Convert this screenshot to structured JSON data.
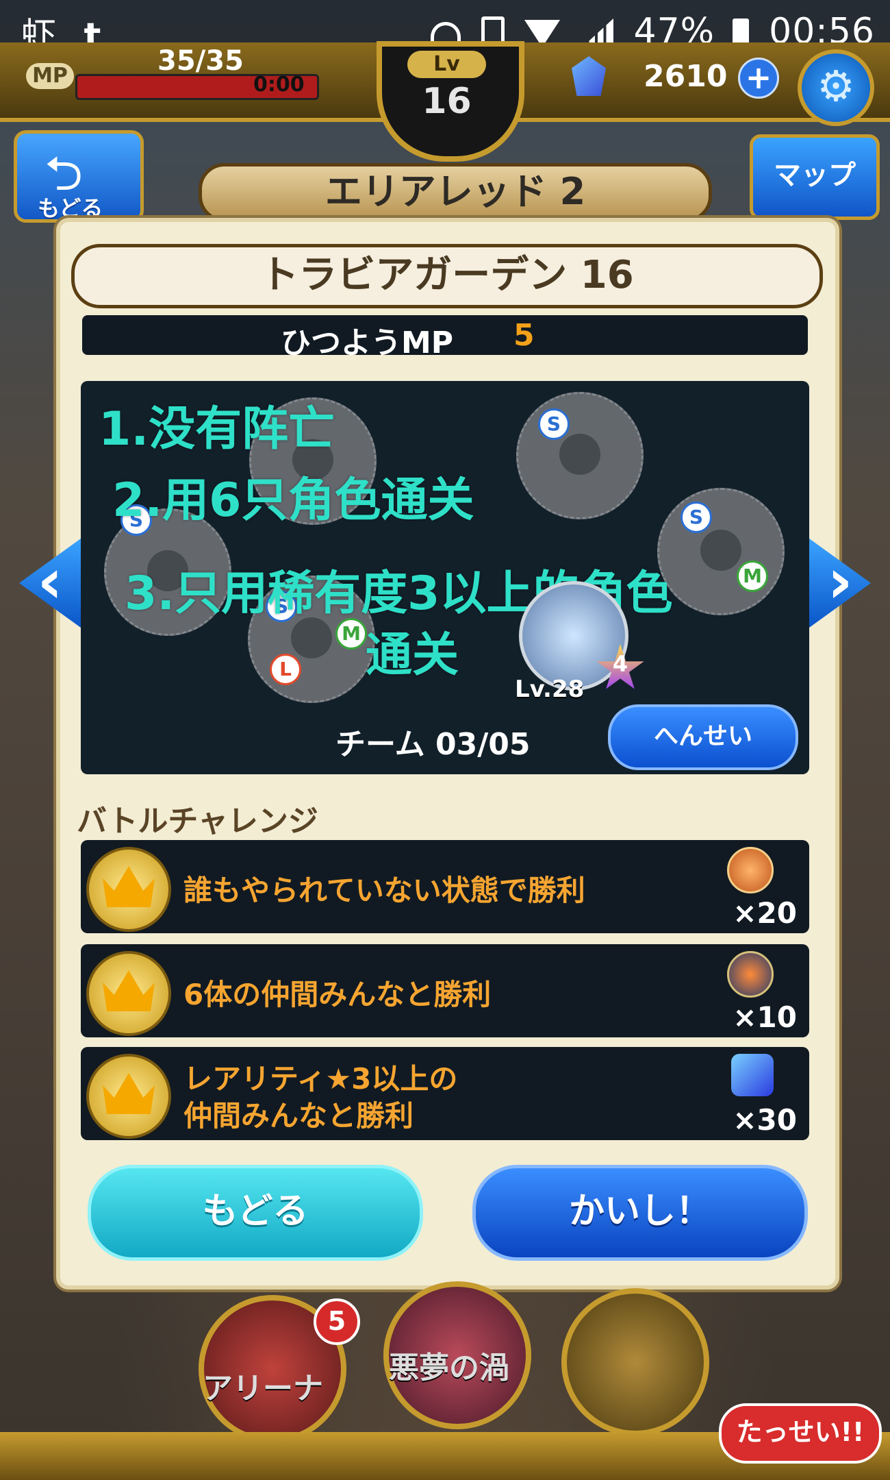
{
  "status_bar": {
    "left_glyph_1": "虾",
    "left_glyph_2": "t",
    "battery": "47%",
    "time": "00:56"
  },
  "hud": {
    "mp_label": "MP",
    "mp_value": "35/35",
    "mp_timer": "0:00",
    "lv_label": "Lv",
    "lv_value": "16",
    "gems": "2610",
    "plus": "+"
  },
  "header": {
    "back_label": "もどる",
    "map_label": "マップ",
    "area_name": "エリアレッド 2"
  },
  "stage": {
    "title": "トラビアガーデン 16",
    "mp_need_label": "ひつようMP",
    "mp_need_value": "5"
  },
  "party": {
    "slot_badges": [
      "S",
      "S",
      "S",
      "M",
      "S",
      "M",
      "L"
    ],
    "hero_level": "Lv.28",
    "hero_rank": "4",
    "team_count": "チーム 03/05",
    "edit_label": "へんせい",
    "annotation_1": "1.没有阵亡",
    "annotation_2": "2.用6只角色通关",
    "annotation_3": "3.只用稀有度3以上的角色",
    "annotation_3b": "通关"
  },
  "challenges": {
    "heading": "バトルチャレンジ",
    "items": [
      {
        "text": "誰もやられていない状態で勝利",
        "reward": "×20",
        "reward_icon": "turtle-medal-icon"
      },
      {
        "text": "6体の仲間みんなと勝利",
        "reward": "×10",
        "reward_icon": "star-medal-icon"
      },
      {
        "text_line1": "レアリティ★3以上の",
        "text_line2": "仲間みんなと勝利",
        "reward": "×30",
        "reward_icon": "gem-icon"
      }
    ]
  },
  "buttons": {
    "back": "もどる",
    "start": "かいし！"
  },
  "nav": {
    "arena": "アリーナ",
    "arena_badge": "5",
    "nightmare": "悪夢の渦",
    "achievement": "たっせい!!"
  },
  "colors": {
    "accent_gold": "#c69b2e",
    "challenge_text": "#f6a531",
    "annotation": "#2fe0c8",
    "mp_need_value": "#f4a11a"
  }
}
